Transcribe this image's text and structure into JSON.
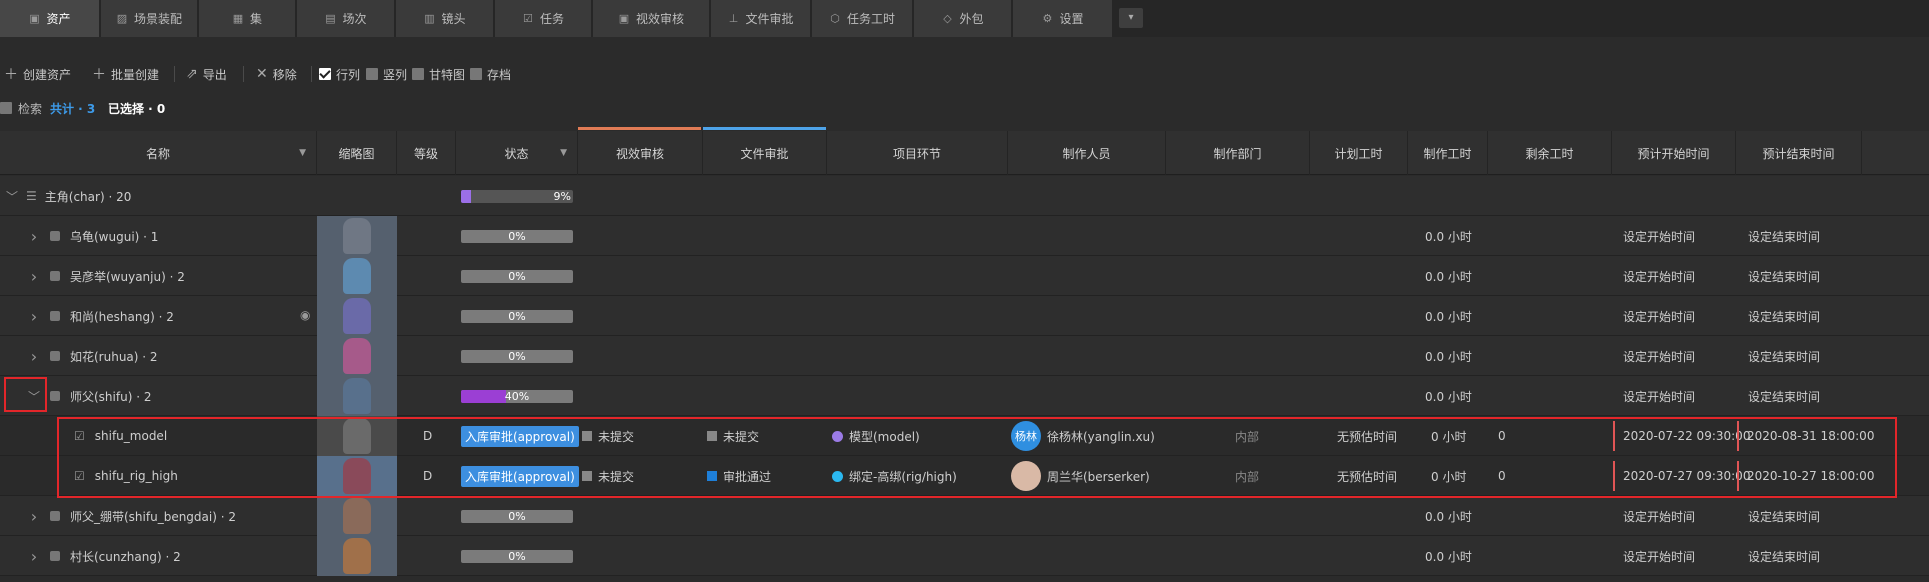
{
  "tabs": [
    {
      "label": "资产",
      "icon": "lock-icon",
      "glyph": "▣"
    },
    {
      "label": "场景装配",
      "icon": "image-icon",
      "glyph": "▨"
    },
    {
      "label": "集",
      "icon": "grid-icon",
      "glyph": "▦"
    },
    {
      "label": "场次",
      "icon": "layers-icon",
      "glyph": "▤"
    },
    {
      "label": "镜头",
      "icon": "film-icon",
      "glyph": "▥"
    },
    {
      "label": "任务",
      "icon": "checklist-icon",
      "glyph": "☑"
    },
    {
      "label": "视效审核",
      "icon": "review-icon",
      "glyph": "▣"
    },
    {
      "label": "文件审批",
      "icon": "stamp-icon",
      "glyph": "⊥"
    },
    {
      "label": "任务工时",
      "icon": "clock-icon",
      "glyph": "⬡"
    },
    {
      "label": "外包",
      "icon": "diamond-icon",
      "glyph": "◇"
    },
    {
      "label": "设置",
      "icon": "gear-icon",
      "glyph": "⚙"
    }
  ],
  "toolbar": {
    "create": "创建资产",
    "batch": "批量创建",
    "export": "导出",
    "remove": "移除",
    "views": [
      {
        "label": "行列",
        "checked": true
      },
      {
        "label": "竖列",
        "checked": false
      },
      {
        "label": "甘特图",
        "checked": false
      },
      {
        "label": "存档",
        "checked": false
      }
    ]
  },
  "status": {
    "search": "检索",
    "total": "共计 · 3",
    "selected": "已选择 · 0"
  },
  "columns": [
    "名称",
    "缩略图",
    "等级",
    "状态",
    "视效审核",
    "文件审批",
    "项目环节",
    "制作人员",
    "制作部门",
    "计划工时",
    "制作工时",
    "剩余工时",
    "预计开始时间",
    "预计结束时间"
  ],
  "group": {
    "label": "主角(char) · 20",
    "progress": 9,
    "progress_label": "9%"
  },
  "assets": [
    {
      "name": "乌龟(wugui) · 1",
      "progress": 0,
      "progress_label": "0%",
      "work": "0.0 小时",
      "start": "设定开始时间",
      "end": "设定结束时间",
      "thumb": "#6f7784"
    },
    {
      "name": "吴彦举(wuyanju) · 2",
      "progress": 0,
      "progress_label": "0%",
      "work": "0.0 小时",
      "start": "设定开始时间",
      "end": "设定结束时间",
      "thumb": "#5d8ab0"
    },
    {
      "name": "和尚(heshang) · 2",
      "progress": 0,
      "progress_label": "0%",
      "work": "0.0 小时",
      "start": "设定开始时间",
      "end": "设定结束时间",
      "thumb": "#6a6aa8"
    },
    {
      "name": "如花(ruhua) · 2",
      "progress": 0,
      "progress_label": "0%",
      "work": "0.0 小时",
      "start": "设定开始时间",
      "end": "设定结束时间",
      "thumb": "#a65a8a"
    },
    {
      "name": "师父(shifu) · 2",
      "progress": 40,
      "progress_label": "40%",
      "work": "0.0 小时",
      "start": "设定开始时间",
      "end": "设定结束时间",
      "thumb": "#58708c"
    }
  ],
  "tasks": [
    {
      "name": "shifu_model",
      "level": "D",
      "status": "入库审批(approval)",
      "vfx": "未提交",
      "file": "未提交",
      "file_color": "#888888",
      "step": "模型(model)",
      "step_color": "#9b7be6",
      "person": "徐杨林(yanglin.xu)",
      "avatar_text": "杨林",
      "avatar_color": "#2f8fe0",
      "dept": "内部",
      "plan": "无预估时间",
      "work": "0 小时",
      "remain": "0",
      "start": "2020-07-22 09:30:00",
      "end": "2020-08-31 18:00:00"
    },
    {
      "name": "shifu_rig_high",
      "level": "D",
      "status": "入库审批(approval)",
      "vfx": "未提交",
      "file": "审批通过",
      "file_color": "#1e7fd8",
      "step": "绑定-高绑(rig/high)",
      "step_color": "#2bb8f0",
      "person": "周兰华(berserker)",
      "avatar_text": "",
      "avatar_color": "#d9b9a6",
      "dept": "内部",
      "plan": "无预估时间",
      "work": "0 小时",
      "remain": "0",
      "start": "2020-07-27 09:30:00",
      "end": "2020-10-27 18:00:00"
    }
  ],
  "assets_after": [
    {
      "name": "师父_绷带(shifu_bengdai) · 2",
      "progress": 0,
      "progress_label": "0%",
      "work": "0.0 小时",
      "start": "设定开始时间",
      "end": "设定结束时间",
      "thumb": "#8a6a5a"
    },
    {
      "name": "村长(cunzhang) · 2",
      "progress": 0,
      "progress_label": "0%",
      "work": "0.0 小时",
      "start": "设定开始时间",
      "end": "设定结束时间",
      "thumb": "#a0704a"
    }
  ],
  "colors": {
    "accent": "#3d8fe0",
    "purple": "#9b4fd8",
    "vfx_line": "#e07b55",
    "file_line": "#4ea3e8",
    "highlight": "#e3262a"
  }
}
